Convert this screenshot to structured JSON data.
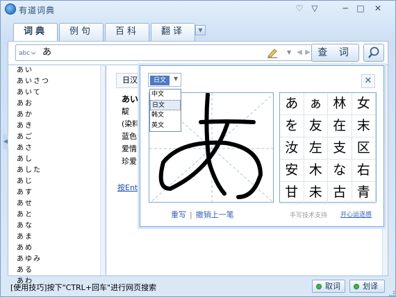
{
  "window": {
    "title": "有道词典",
    "controls": {
      "feedback": "♡",
      "menu": "▽",
      "minimize": "─",
      "maximize": "□",
      "close": "✕"
    }
  },
  "tabs": [
    {
      "label": "词典",
      "active": true
    },
    {
      "label": "例句",
      "active": false
    },
    {
      "label": "百科",
      "active": false
    },
    {
      "label": "翻译",
      "active": false
    }
  ],
  "search": {
    "query": "あ",
    "button_label": "查 词"
  },
  "word_list": [
    "あい",
    "あいさつ",
    "あいて",
    "あお",
    "あか",
    "あき",
    "あご",
    "あさ",
    "あし",
    "あした",
    "あじ",
    "あす",
    "あせ",
    "あと",
    "あな",
    "あま",
    "あめ",
    "あゆみ",
    "ある",
    "あわ"
  ],
  "result": {
    "tab_label": "日汉",
    "word": "あい",
    "lines": [
      "靛",
      "(染料",
      "蓝色",
      "爱情",
      "珍爱"
    ],
    "enter_hint": "按Enter"
  },
  "handwriting": {
    "language_value": "日文",
    "language_options": [
      {
        "label": "中文",
        "selected": false
      },
      {
        "label": "日文",
        "selected": true
      },
      {
        "label": "韩文",
        "selected": false
      },
      {
        "label": "英文",
        "selected": false
      }
    ],
    "rewrite_label": "重写",
    "undo_label": "撤销上一笔",
    "candidates": [
      "あ",
      "ぁ",
      "林",
      "女",
      "を",
      "友",
      "在",
      "末",
      "汝",
      "左",
      "支",
      "区",
      "安",
      "木",
      "な",
      "右",
      "甘",
      "未",
      "古",
      "青"
    ],
    "support_text": "手写技术支持",
    "support_link": "开心运逐感"
  },
  "status": {
    "tip": "[使用技巧]按下\"CTRL+回车\"进行网页搜索",
    "cancel_label": "取词",
    "translate_label": "划译"
  },
  "colors": {
    "accent": "#3563b4",
    "panel_border": "#7ea8d4",
    "button_green": "#47b14a"
  }
}
